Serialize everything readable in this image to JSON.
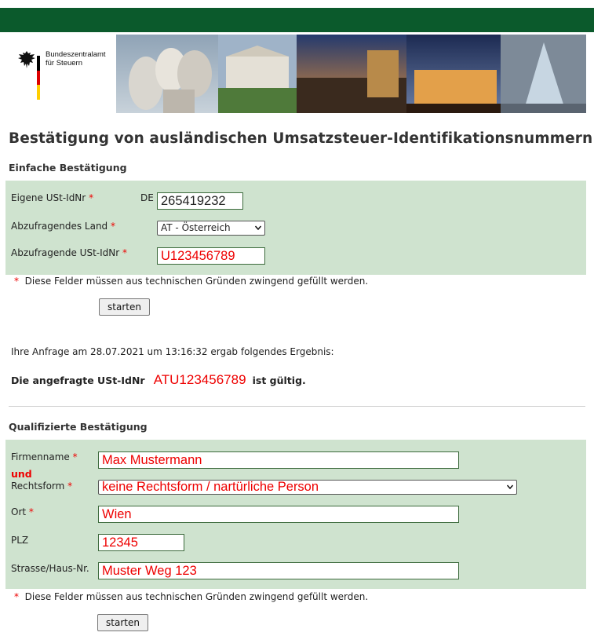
{
  "header": {
    "logo_line1": "Bundeszentralamt",
    "logo_line2": "für Steuern",
    "flag_colors": [
      "#000000",
      "#dd0000",
      "#ffce00"
    ],
    "bar_color": "#0b5a2c"
  },
  "page_title": "Bestätigung von ausländischen Umsatzsteuer-Identifikationsnummern",
  "simple": {
    "heading": "Einfache Bestätigung",
    "own_vat_label": "Eigene USt-IdNr",
    "own_vat_prefix": "DE",
    "own_vat_value": "265419232",
    "country_label": "Abzufragendes Land",
    "country_value": "AT - Österreich",
    "query_vat_label": "Abzufragende USt-IdNr",
    "query_vat_value": "U123456789",
    "required_marker": "*",
    "required_note": "Diese Felder müssen aus technischen Gründen zwingend gefüllt werden.",
    "start_button": "starten"
  },
  "result": {
    "line": "Ihre Anfrage am 28.07.2021 um 13:16:32 ergab folgendes Ergebnis:",
    "prefix": "Die angefragte USt-IdNr",
    "vat": "ATU123456789",
    "suffix": "ist gültig."
  },
  "qualified": {
    "heading": "Qualifizierte Bestätigung",
    "company_label": "Firmenname",
    "company_value": "Max Mustermann",
    "and_label": "und",
    "legal_form_label": "Rechtsform",
    "legal_form_value": "keine Rechtsform / nartürliche Person",
    "city_label": "Ort",
    "city_value": "Wien",
    "zip_label": "PLZ",
    "zip_value": "12345",
    "street_label": "Strasse/Haus-Nr.",
    "street_value": "Muster Weg 123",
    "required_marker": "*",
    "required_note": "Diese Felder müssen aus technischen Gründen zwingend gefüllt werden.",
    "start_button": "starten"
  },
  "colors": {
    "panel_green": "#cfe3cf",
    "required_red": "#e00000"
  },
  "icons": {
    "eagle": "federal-eagle-icon",
    "select_arrow": "chevron-down-icon"
  }
}
